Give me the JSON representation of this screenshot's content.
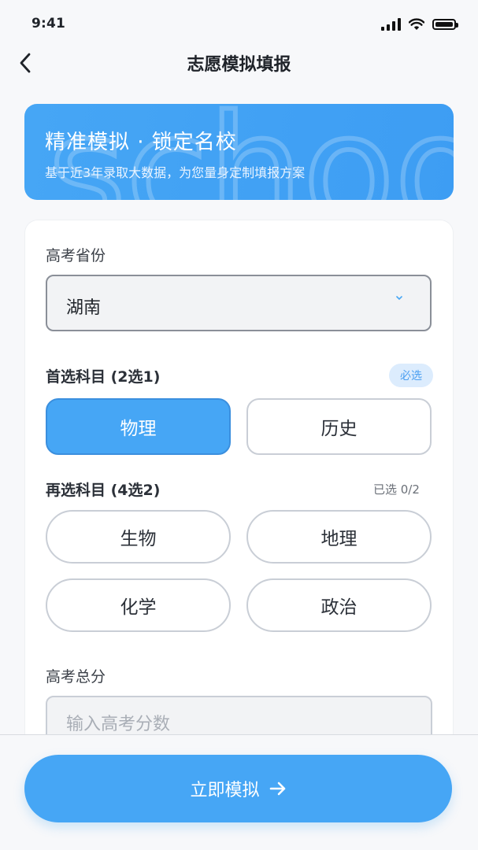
{
  "status_bar": {
    "time": "9:41"
  },
  "nav": {
    "title": "志愿模拟填报"
  },
  "banner": {
    "title": "精准模拟 · 锁定名校",
    "subtitle": "基于近3年录取大数据，为您量身定制填报方案",
    "watermark": "school"
  },
  "form": {
    "province": {
      "label": "高考省份",
      "value": "湖南"
    },
    "primary_subject": {
      "label": "首选科目 (2选1)",
      "badge": "必选",
      "options": [
        "物理",
        "历史"
      ],
      "selected": "物理"
    },
    "secondary_subject": {
      "label": "再选科目 (4选2)",
      "counter": "已选 0/2",
      "options": [
        "生物",
        "地理",
        "化学",
        "政治"
      ]
    },
    "score": {
      "label": "高考总分",
      "placeholder": "输入高考分数"
    }
  },
  "cta": {
    "label": "立即模拟"
  },
  "colors": {
    "accent": "#46a6f5",
    "badge_bg": "#dcecfd",
    "page_bg": "#f7f8fa"
  }
}
